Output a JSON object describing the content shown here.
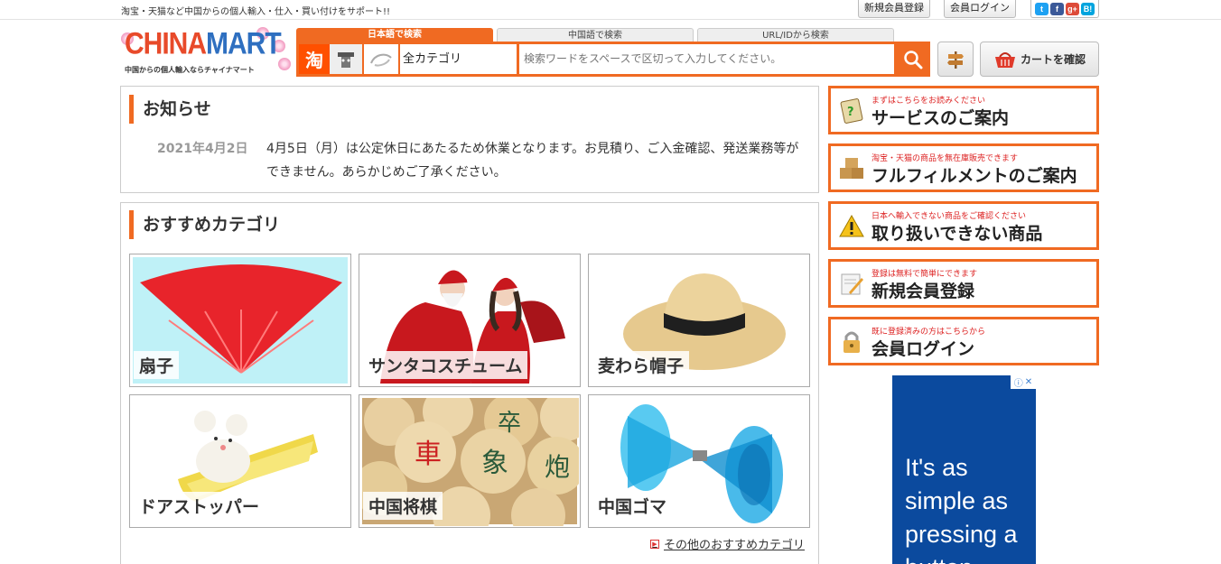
{
  "topbar": {
    "tagline": "淘宝・天猫など中国からの個人輸入・仕入・買い付けをサポート!!",
    "register_label": "新規会員登録",
    "login_label": "会員ログイン",
    "social": [
      "twitter-icon",
      "facebook-icon",
      "google-plus-icon",
      "hatena-icon"
    ]
  },
  "logo": {
    "title_a": "CHINA",
    "title_b": "MART",
    "subtitle": "中国からの個人輸入ならチャイナマート"
  },
  "search": {
    "tabs": [
      "日本語で検索",
      "中国語で検索",
      "URL/IDから検索"
    ],
    "active_tab": 0,
    "taobao_glyph": "淘",
    "category": "全カテゴリ",
    "placeholder": "検索ワードをスペースで区切って入力してください。",
    "cart_label": "カートを確認"
  },
  "news": {
    "title": "お知らせ",
    "date": "2021年4月2日",
    "text": "4月5日（月）は公定休日にあたるため休業となります。お見積り、ご入金確認、発送業務等ができません。あらかじめご了承ください。"
  },
  "categories": {
    "title": "おすすめカテゴリ",
    "items": [
      {
        "label": "扇子"
      },
      {
        "label": "サンタコスチューム"
      },
      {
        "label": "麦わら帽子"
      },
      {
        "label": "ドアストッパー"
      },
      {
        "label": "中国将棋"
      },
      {
        "label": "中国ゴマ"
      }
    ],
    "more_label": "その他のおすすめカテゴリ"
  },
  "sidebar": {
    "items": [
      {
        "small": "まずはこちらをお読みください",
        "big": "サービスのご案内",
        "icon": "guide-icon"
      },
      {
        "small": "淘宝・天猫の商品を無在庫販売できます",
        "big": "フルフィルメントのご案内",
        "icon": "boxes-icon"
      },
      {
        "small": "日本へ輸入できない商品をご確認ください",
        "big": "取り扱いできない商品",
        "icon": "warning-icon"
      },
      {
        "small": "登録は無料で簡単にできます",
        "big": "新規会員登録",
        "icon": "register-icon"
      },
      {
        "small": "既に登録済みの方はこちらから",
        "big": "会員ログイン",
        "icon": "lock-icon"
      }
    ]
  },
  "ad": {
    "text": "It's as simple as pressing a button"
  },
  "colors": {
    "accent": "#f06a22",
    "ad_bg": "#0b4a9e"
  }
}
